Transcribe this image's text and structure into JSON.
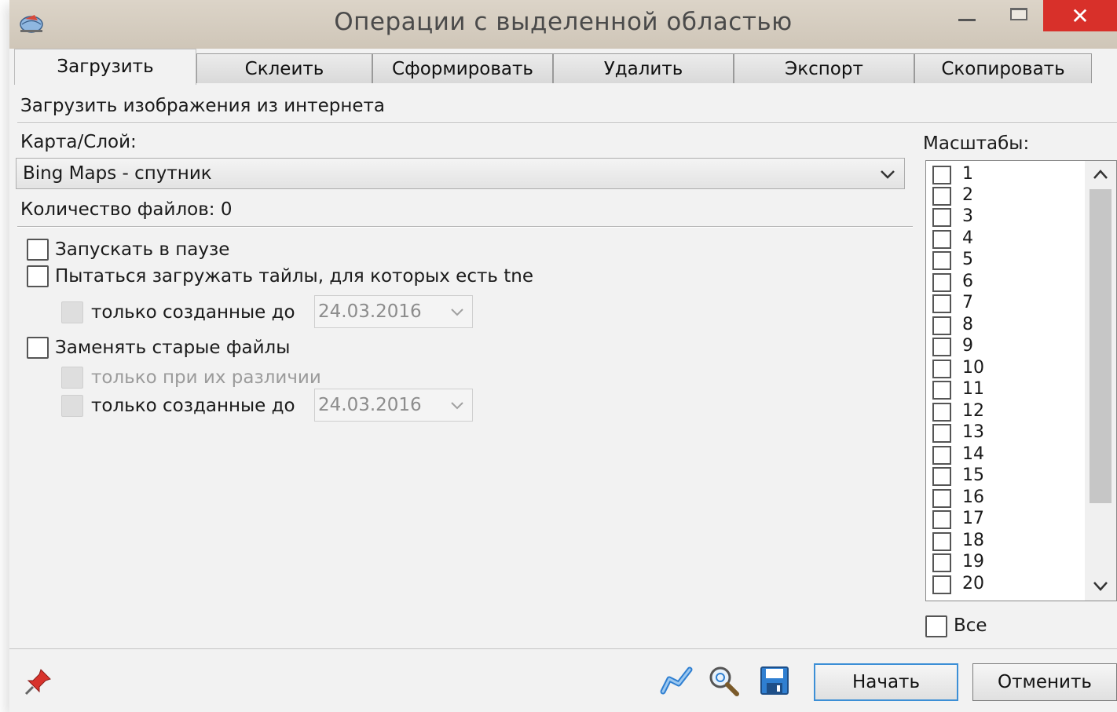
{
  "window": {
    "title": "Операции с выделенной областью",
    "close_glyph": "✕"
  },
  "tabs": [
    {
      "label": "Загрузить",
      "active": true
    },
    {
      "label": "Склеить",
      "active": false
    },
    {
      "label": "Сформировать",
      "active": false
    },
    {
      "label": "Удалить",
      "active": false
    },
    {
      "label": "Экспорт",
      "active": false
    },
    {
      "label": "Скопировать",
      "active": false
    }
  ],
  "download": {
    "heading": "Загрузить изображения из интернета",
    "map_layer_label": "Карта/Слой:",
    "map_layer_value": "Bing Maps - спутник",
    "file_count": "Количество файлов: 0",
    "start_paused_label": "Запускать в паузе",
    "try_load_tne_label": "Пытаться загружать тайлы, для которых есть tne",
    "only_created_before_label": "только созданные до",
    "tne_date": "24.03.2016",
    "replace_old_label": "Заменять старые файлы",
    "only_if_different_label": "только при их различии",
    "replace_date": "24.03.2016"
  },
  "scales": {
    "label": "Масштабы:",
    "items": [
      "1",
      "2",
      "3",
      "4",
      "5",
      "6",
      "7",
      "8",
      "9",
      "10",
      "11",
      "12",
      "13",
      "14",
      "15",
      "16",
      "17",
      "18",
      "19",
      "20"
    ],
    "all_label": "Все"
  },
  "footer": {
    "start_label": "Начать",
    "cancel_label": "Отменить"
  },
  "colors": {
    "close_button": "#d8302a",
    "primary_border": "#3c8fd6",
    "icon_blue": "#2f7fd1"
  }
}
